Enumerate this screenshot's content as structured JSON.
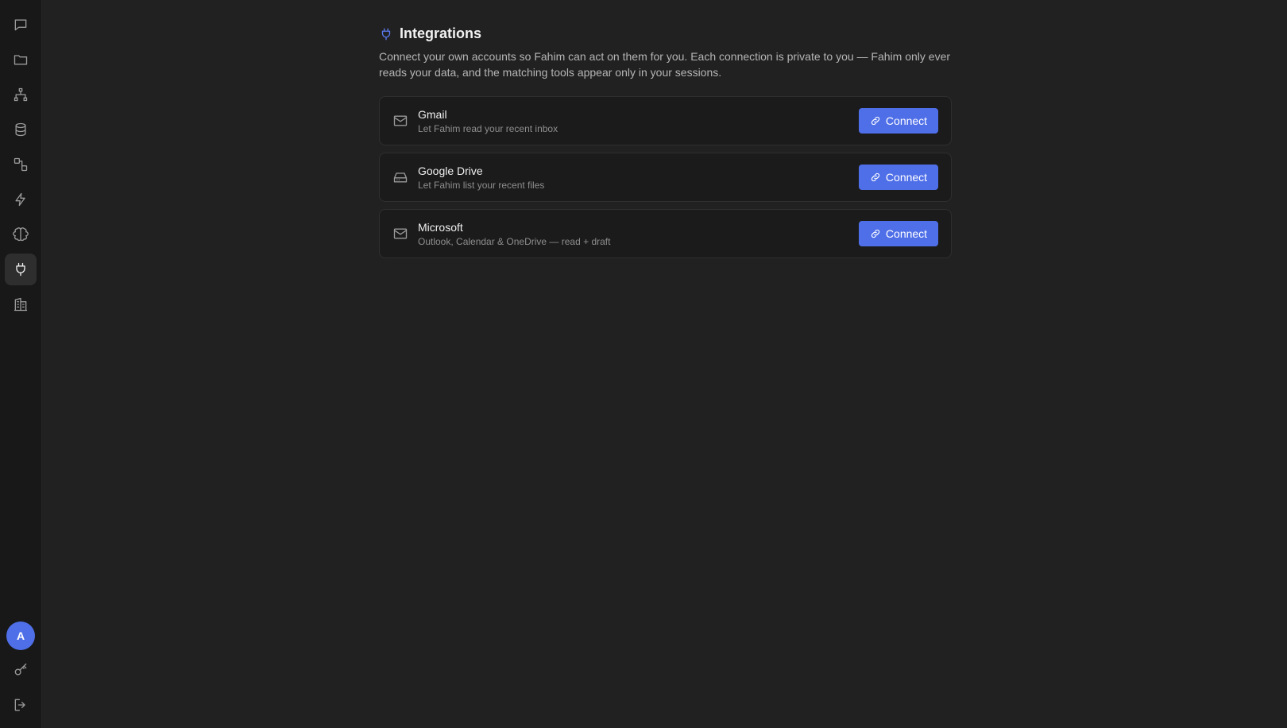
{
  "sidebar": {
    "nav": [
      {
        "icon": "chat-icon"
      },
      {
        "icon": "folder-icon"
      },
      {
        "icon": "hierarchy-icon"
      },
      {
        "icon": "database-icon"
      },
      {
        "icon": "workflow-icon"
      },
      {
        "icon": "lightning-icon"
      },
      {
        "icon": "brain-icon"
      },
      {
        "icon": "plug-icon",
        "active": true
      },
      {
        "icon": "building-icon"
      }
    ],
    "avatar_initial": "A",
    "bottom": [
      {
        "icon": "key-icon"
      },
      {
        "icon": "logout-icon"
      }
    ]
  },
  "header": {
    "title": "Integrations",
    "description": "Connect your own accounts so Fahim can act on them for you. Each connection is private to you — Fahim only ever reads your data, and the matching tools appear only in your sessions."
  },
  "integrations": [
    {
      "name": "Gmail",
      "description": "Let Fahim read your recent inbox",
      "icon": "mail-icon",
      "button_label": "Connect"
    },
    {
      "name": "Google Drive",
      "description": "Let Fahim list your recent files",
      "icon": "hard-drive-icon",
      "button_label": "Connect"
    },
    {
      "name": "Microsoft",
      "description": "Outlook, Calendar & OneDrive — read + draft",
      "icon": "mail-icon",
      "button_label": "Connect"
    }
  ],
  "colors": {
    "accent": "#4f6fe8",
    "background": "#212121",
    "sidebar": "#181818"
  }
}
